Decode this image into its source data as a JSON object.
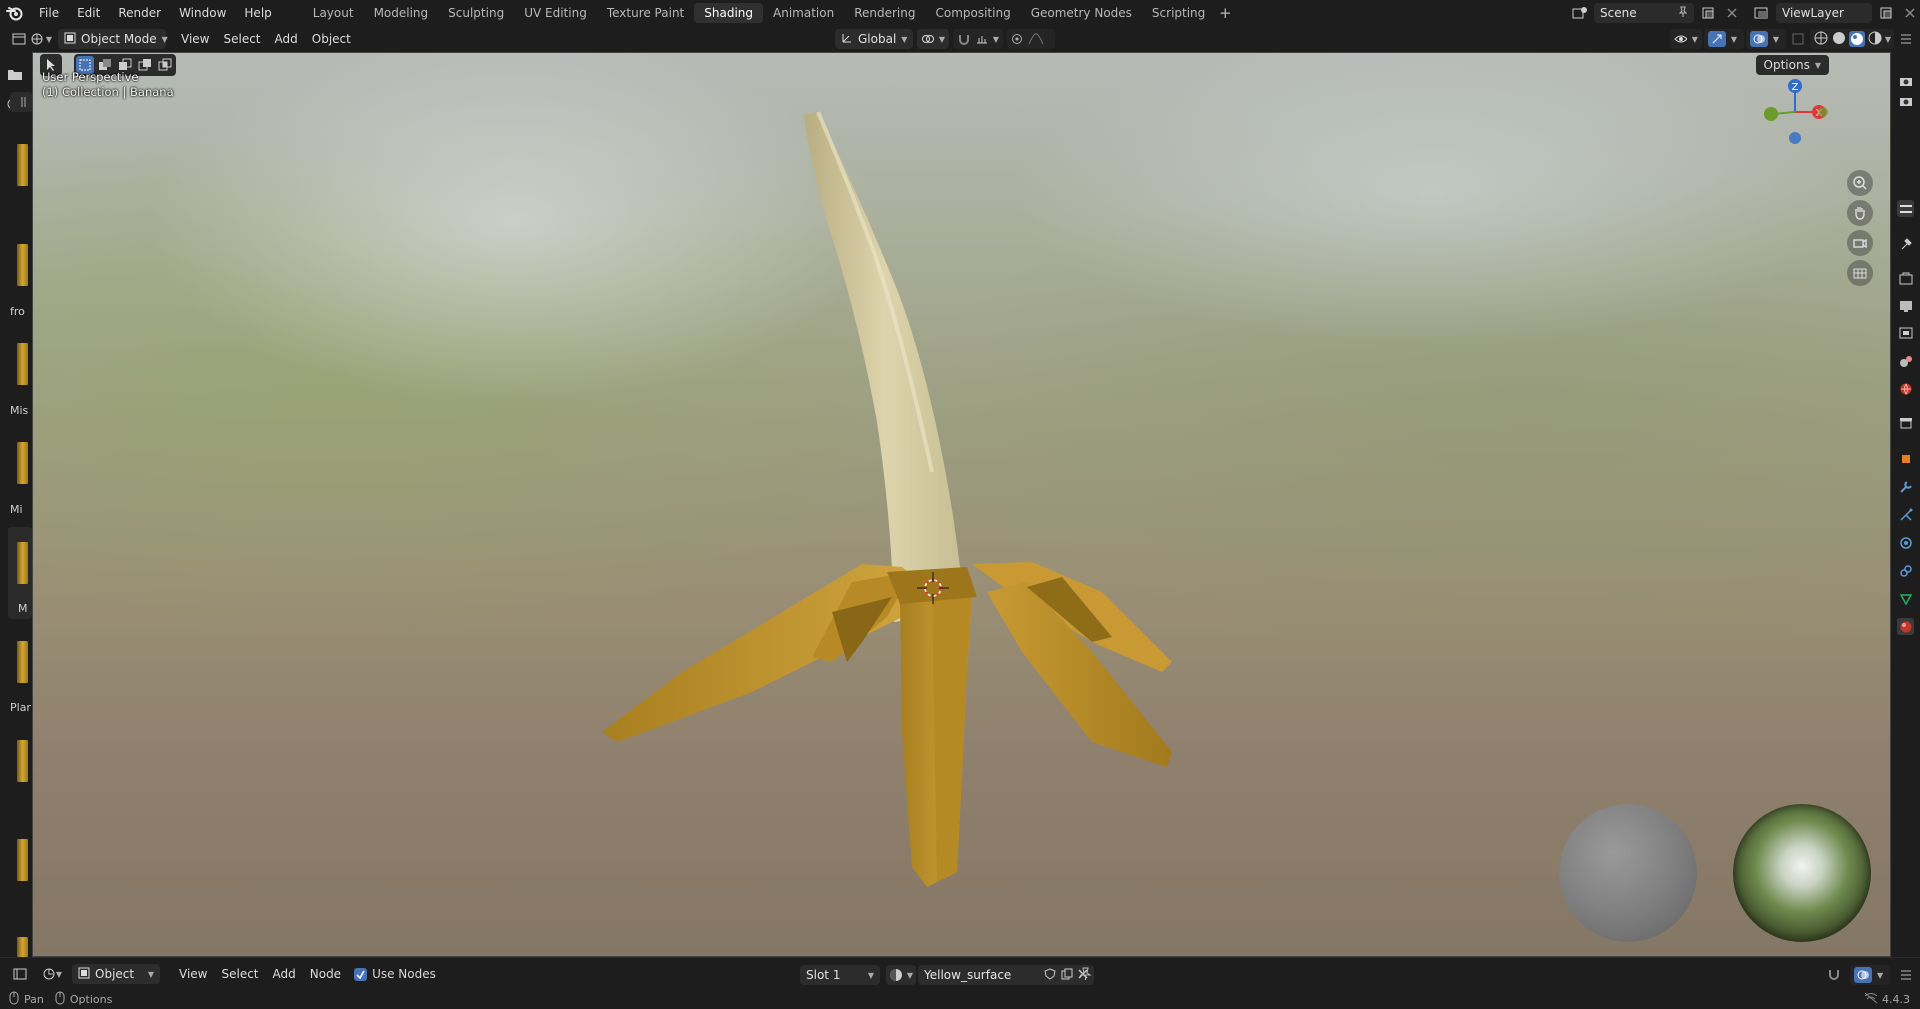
{
  "topbar": {
    "menus": [
      "File",
      "Edit",
      "Render",
      "Window",
      "Help"
    ],
    "workspaces": [
      "Layout",
      "Modeling",
      "Sculpting",
      "UV Editing",
      "Texture Paint",
      "Shading",
      "Animation",
      "Rendering",
      "Compositing",
      "Geometry Nodes",
      "Scripting"
    ],
    "active_workspace": "Shading",
    "add_workspace": "+",
    "scene_name": "Scene",
    "view_layer": "ViewLayer"
  },
  "viewport_header": {
    "mode": "Object Mode",
    "menus": [
      "View",
      "Select",
      "Add",
      "Object"
    ],
    "transform_orientation": "Global"
  },
  "viewport": {
    "perspective_label": "User Perspective",
    "collection_label": "(1) Collection | Banana",
    "options_label": "Options",
    "gizmo": {
      "z": "Z",
      "x": "X"
    }
  },
  "asset_sidebar": {
    "labels": [
      "fro",
      "Mis",
      "Mi",
      "M",
      "Plar"
    ]
  },
  "node_header": {
    "editor_type": "Object",
    "menus": [
      "View",
      "Select",
      "Add",
      "Node"
    ],
    "use_nodes_label": "Use Nodes",
    "use_nodes_checked": true,
    "slot": "Slot 1",
    "material_name": "Yellow_surface"
  },
  "statusbar": {
    "pan_label": "Pan",
    "options_label": "Options",
    "version": "4.4.3"
  },
  "colors": {
    "accent": "#4772b3",
    "banana_peel": "#c9a035",
    "banana_flesh": "#e0d6ad",
    "axis_x": "#e0373c",
    "axis_y": "#6b9b2a",
    "axis_z": "#2f6dc9"
  }
}
